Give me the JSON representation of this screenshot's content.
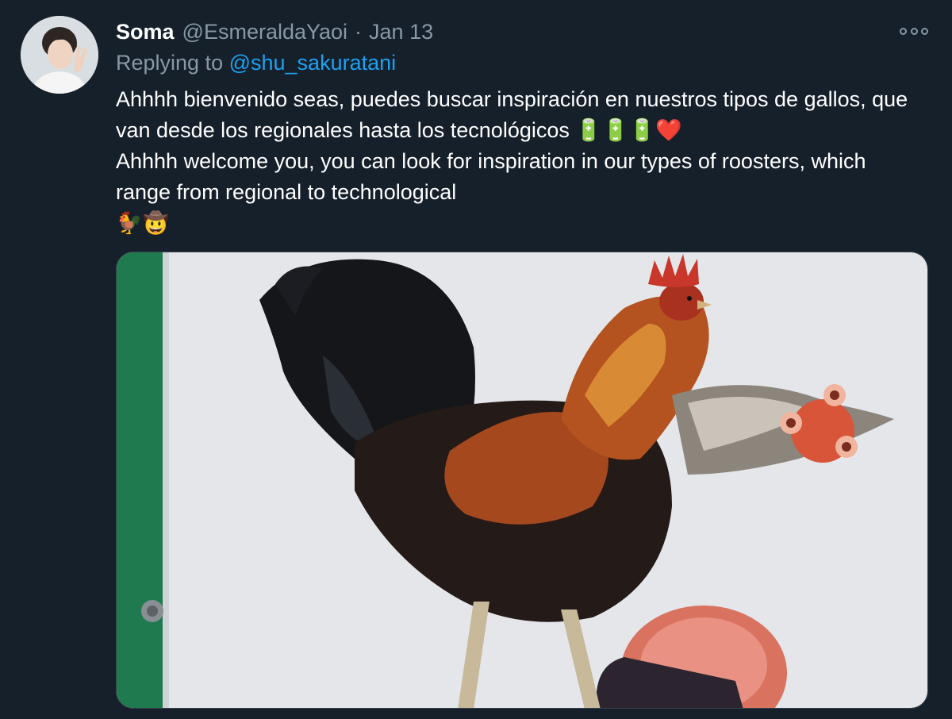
{
  "tweet": {
    "display_name": "Soma",
    "handle": "@EsmeraldaYaoi",
    "separator": "·",
    "date": "Jan 13",
    "reply_prefix": "Replying to ",
    "reply_to": "@shu_sakuratani",
    "text": "Ahhhh bienvenido seas, puedes buscar inspiración en nuestros tipos de gallos, que van desde los regionales hasta los tecnológicos 🔋🔋🔋❤️\nAhhhh welcome you, you can look for inspiration in our types of roosters, which range from regional to technological\n🐓🤠"
  },
  "icons": {
    "more": "more-options-icon",
    "avatar": "user-avatar",
    "media": "rooster-photo"
  },
  "colors": {
    "background": "#15202b",
    "secondary_text": "#8899a6",
    "link": "#1da1f2"
  }
}
